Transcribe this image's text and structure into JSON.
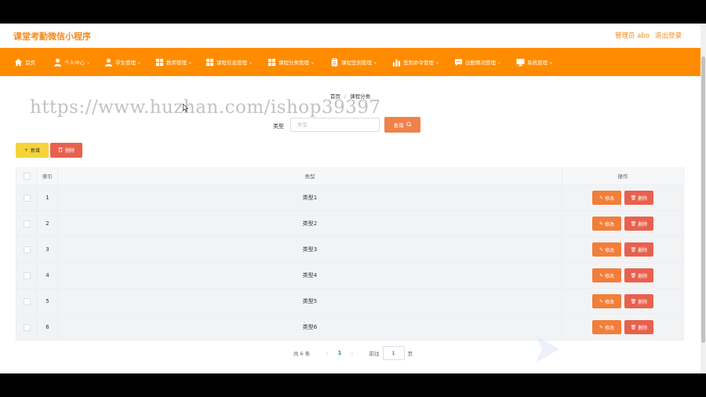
{
  "app": {
    "title": "课堂考勤微信小程序",
    "user": "管理员 abo",
    "logout": "退出登录"
  },
  "nav": [
    {
      "label": "首页",
      "icon": "home-icon"
    },
    {
      "label": "个人中心",
      "icon": "user-icon"
    },
    {
      "label": "学生管理",
      "icon": "user-icon"
    },
    {
      "label": "教师管理",
      "icon": "grid-icon"
    },
    {
      "label": "课程信息管理",
      "icon": "grid-icon"
    },
    {
      "label": "课程分类管理",
      "icon": "grid-icon"
    },
    {
      "label": "课程签到管理",
      "icon": "clipboard-icon"
    },
    {
      "label": "签到命令管理",
      "icon": "bar-chart-icon"
    },
    {
      "label": "出勤情况管理",
      "icon": "chat-icon"
    },
    {
      "label": "系统管理",
      "icon": "monitor-icon"
    }
  ],
  "breadcrumb": {
    "home": "首页",
    "sep": "/",
    "current": "课程分类"
  },
  "watermark": "https://www.huzhan.com/ishop39397",
  "search": {
    "label": "类型",
    "placeholder": "类型",
    "button": "查询"
  },
  "actions": {
    "add": "新增",
    "delete": "删除"
  },
  "table": {
    "headers": {
      "index": "索引",
      "type": "类型",
      "ops": "操作"
    },
    "edit_label": "修改",
    "delete_label": "删除",
    "rows": [
      {
        "index": "1",
        "type": "类型1"
      },
      {
        "index": "2",
        "type": "类型2"
      },
      {
        "index": "3",
        "type": "类型3"
      },
      {
        "index": "4",
        "type": "类型4"
      },
      {
        "index": "5",
        "type": "类型5"
      },
      {
        "index": "6",
        "type": "类型6"
      }
    ]
  },
  "pagination": {
    "total": "共 6 条",
    "current": "1",
    "goto": "前往",
    "goto_value": "1",
    "unit": "页"
  },
  "colors": {
    "accent": "#ff8c00",
    "title": "#f38b1f",
    "danger": "#e8614d",
    "warning": "#f7d33a"
  }
}
